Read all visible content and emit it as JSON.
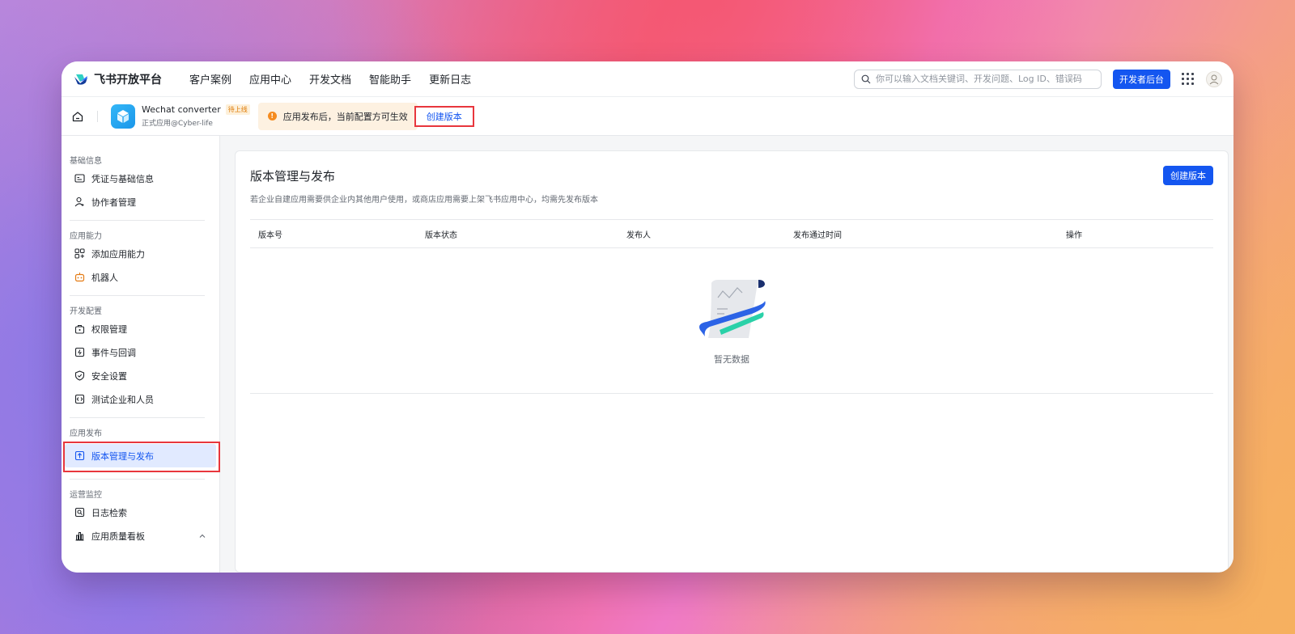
{
  "topnav": {
    "logo_text": "飞书开放平台",
    "links": [
      "客户案例",
      "应用中心",
      "开发文档",
      "智能助手",
      "更新日志"
    ],
    "search_placeholder": "你可以输入文档关键词、开发问题、Log ID、错误码",
    "console_button": "开发者后台"
  },
  "app": {
    "name": "Wechat converter",
    "badge": "待上线",
    "subtitle": "正式应用@Cyber-life"
  },
  "notice": {
    "text": "应用发布后，当前配置方可生效",
    "button": "创建版本"
  },
  "sidebar": {
    "groups": [
      {
        "title": "基础信息",
        "items": [
          "凭证与基础信息",
          "协作者管理"
        ]
      },
      {
        "title": "应用能力",
        "items": [
          "添加应用能力",
          "机器人"
        ]
      },
      {
        "title": "开发配置",
        "items": [
          "权限管理",
          "事件与回调",
          "安全设置",
          "测试企业和人员"
        ]
      },
      {
        "title": "应用发布",
        "items": [
          "版本管理与发布"
        ]
      },
      {
        "title": "运营监控",
        "items": [
          "日志检索",
          "应用质量看板"
        ]
      }
    ]
  },
  "main": {
    "title": "版本管理与发布",
    "description": "若企业自建应用需要供企业内其他用户使用，或商店应用需要上架飞书应用中心，均需先发布版本",
    "create_button": "创建版本",
    "columns": [
      "版本号",
      "版本状态",
      "发布人",
      "发布通过时间",
      "操作"
    ],
    "empty_text": "暂无数据"
  },
  "colors": {
    "primary": "#1456f0",
    "highlight_border": "#e8363d",
    "notice_bg": "#fdf1e1",
    "warning": "#f58b1f"
  }
}
